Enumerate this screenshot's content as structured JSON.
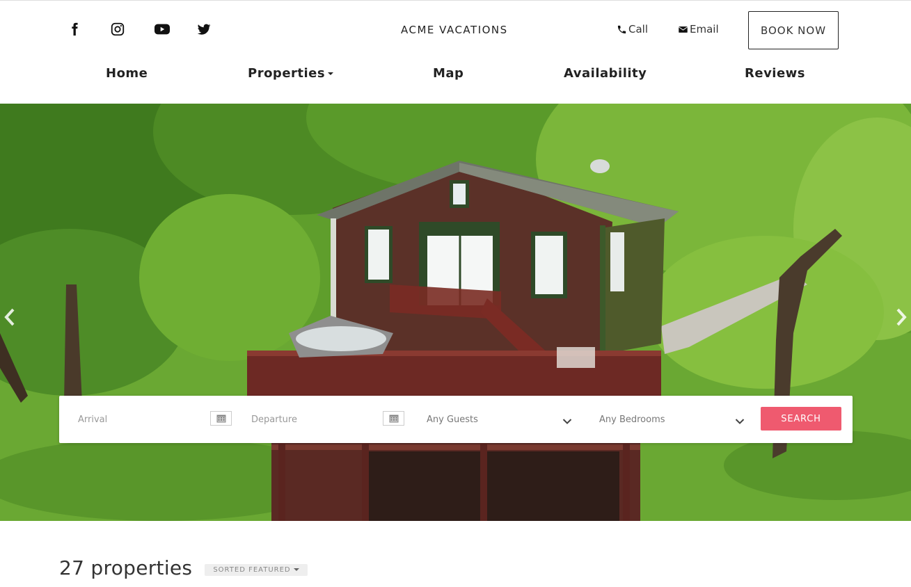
{
  "header": {
    "brand": "ACME VACATIONS",
    "social": [
      "facebook-icon",
      "instagram-icon",
      "youtube-icon",
      "twitter-icon"
    ],
    "call_label": "Call",
    "email_label": "Email",
    "book_label": "BOOK NOW"
  },
  "nav": {
    "items": [
      {
        "label": "Home"
      },
      {
        "label": "Properties"
      },
      {
        "label": "Map"
      },
      {
        "label": "Availability"
      },
      {
        "label": "Reviews"
      }
    ]
  },
  "search": {
    "arrival_placeholder": "Arrival",
    "departure_placeholder": "Departure",
    "guests_value": "Any Guests",
    "bedrooms_value": "Any Bedrooms",
    "button_label": "SEARCH"
  },
  "results": {
    "count_label": "27 properties",
    "sort_label": "SORTED FEATURED"
  },
  "colors": {
    "accent": "#ef5a6f",
    "text": "#222222"
  }
}
